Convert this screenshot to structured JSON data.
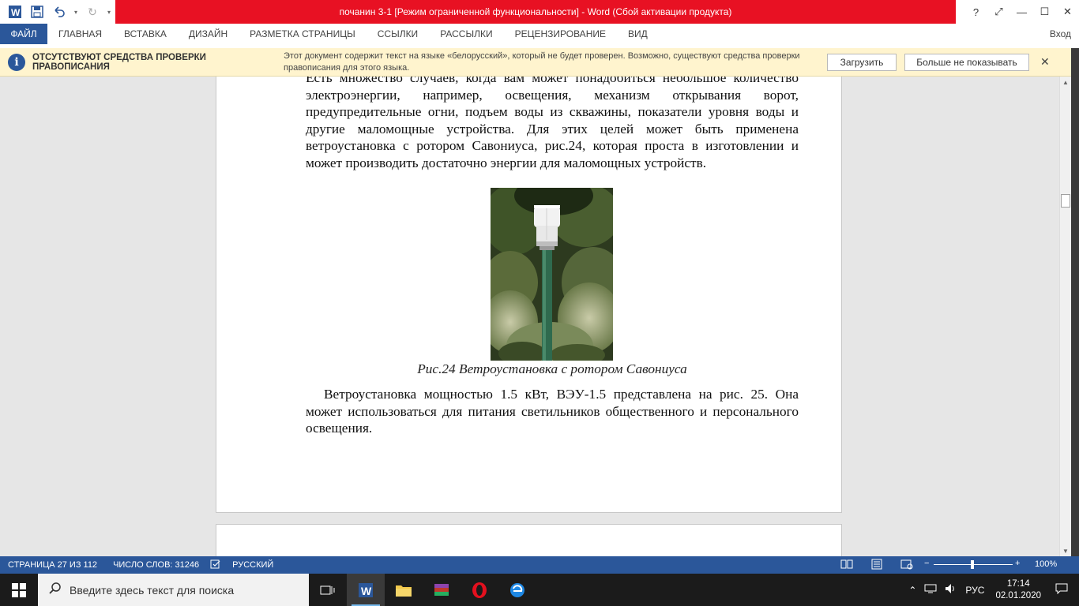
{
  "title": "почанин 3-1 [Режим ограниченной функциональности] -  Word (Сбой активации продукта)",
  "window_controls": {
    "help": "?",
    "restore_ribbon": "⤢",
    "minimize": "—",
    "maximize": "☐",
    "close": "✕"
  },
  "ribbon": {
    "tabs": [
      "ФАЙЛ",
      "ГЛАВНАЯ",
      "ВСТАВКА",
      "ДИЗАЙН",
      "РАЗМЕТКА СТРАНИЦЫ",
      "ССЫЛКИ",
      "РАССЫЛКИ",
      "РЕЦЕНЗИРОВАНИЕ",
      "ВИД"
    ],
    "login": "Вход"
  },
  "message_bar": {
    "title": "ОТСУТСТВУЮТ СРЕДСТВА ПРОВЕРКИ ПРАВОПИСАНИЯ",
    "text": "Этот документ содержит текст на языке «белорусский», который не будет проверен. Возможно, существуют средства проверки правописания для этого языка.",
    "download_button": "Загрузить",
    "dont_show_button": "Больше не показывать"
  },
  "document": {
    "paragraph1": "Есть множество случаев, когда вам может понадобиться небольшое количество электроэнергии, например, освещения, механизм открывания ворот, предупредительные огни, подъем воды из скважины, показатели уровня воды и другие маломощные устройства. Для этих целей может быть применена ветроустановка с ротором Савониуса, рис.24, которая проста в изготовлении и может производить достаточно энергии для маломощных устройств.",
    "caption": "Рис.24 Ветроустановка с ротором Савониуса",
    "paragraph2": "Ветроустановка мощностью 1.5 кВт, ВЭУ-1.5 представлена на рис. 25. Она может использоваться для питания светильников общественного и персонального освещения."
  },
  "status_bar": {
    "page": "СТРАНИЦА 27 ИЗ 112",
    "words": "ЧИСЛО СЛОВ: 31246",
    "language": "РУССКИЙ",
    "zoom": "100%",
    "zoom_minus": "−",
    "zoom_plus": "+"
  },
  "taskbar": {
    "search_placeholder": "Введите здесь текст для поиска",
    "language": "РУС",
    "time": "17:14",
    "date": "02.01.2020"
  },
  "colors": {
    "word_blue": "#2b579a",
    "title_red": "#e81123",
    "message_bar": "#fff4ce"
  }
}
